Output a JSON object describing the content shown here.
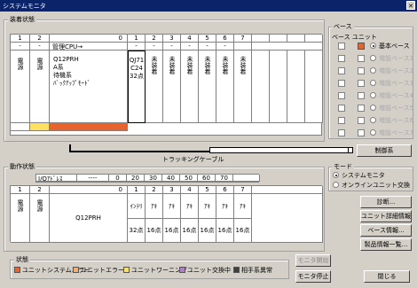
{
  "window": {
    "title": "システムモニタ"
  },
  "mount": {
    "label": "装着状態",
    "slot_numbers": [
      "1",
      "2",
      "",
      "0",
      "1",
      "2",
      "3",
      "4",
      "5",
      "6",
      "7"
    ],
    "dashes": [
      "-",
      "-",
      "-",
      "-",
      "-",
      "-",
      "-",
      "-"
    ],
    "manage_cpu": "管理CPU→",
    "power1": "電源",
    "power2": "電源",
    "cpu_lines": [
      "Q12PRH",
      "A系",
      "待機系",
      "ﾊﾞｯｸｱｯﾌﾟﾓｰﾄﾞ"
    ],
    "unit_lines": [
      "QJ71",
      "C24",
      "32点"
    ],
    "unmounted": "未装着"
  },
  "tracking_cable": "トラッキングケーブル",
  "control_system_button": "制御系",
  "operation": {
    "label": "動作状態",
    "io_address": "I/Oｱﾄﾞﾚｽ",
    "addresses": [
      "----",
      "0",
      "20",
      "30",
      "40",
      "50",
      "60",
      "70"
    ],
    "slot_numbers": [
      "1",
      "2",
      "",
      "0",
      "1",
      "2",
      "3",
      "4",
      "5",
      "6",
      "7"
    ],
    "power1": "電源",
    "power2": "電源",
    "cpu": "Q12PRH",
    "intelli": "ｲﾝﾃﾘ",
    "intelli_pts": "32点",
    "empty": "ｱｷ",
    "empty_pts": "16点"
  },
  "base": {
    "label": "ベース",
    "cols": "ベース ユニット",
    "basic_base": "基本ベース",
    "ext_bases": [
      "増設ベース1",
      "増設ベース2",
      "増設ベース3",
      "増設ベース4",
      "増設ベース5",
      "増設ベース6",
      "増設ベース7"
    ]
  },
  "mode": {
    "label": "モード",
    "system_monitor": "システムモニタ",
    "online_change": "オンラインユニット交換"
  },
  "buttons": {
    "diagnosis": "診断...",
    "unit_detail": "ユニット詳細情報...",
    "base_info": "ベース情報...",
    "product_info": "製品情報一覧...",
    "start_monitor": "モニタ開始",
    "stop_monitor": "モニタ停止",
    "close": "閉じる"
  },
  "legend": {
    "label": "状態",
    "items": [
      "ユニットシステムエラー",
      "ユニットエラー",
      "ユニットワーニング",
      "ユニット交換中",
      "相手系異常"
    ]
  },
  "colors": {
    "sys_error": "#e8642c",
    "unit_error": "#f0b070",
    "warning": "#ffe060",
    "replacing": "#b080c8",
    "other_error": "#404040"
  }
}
